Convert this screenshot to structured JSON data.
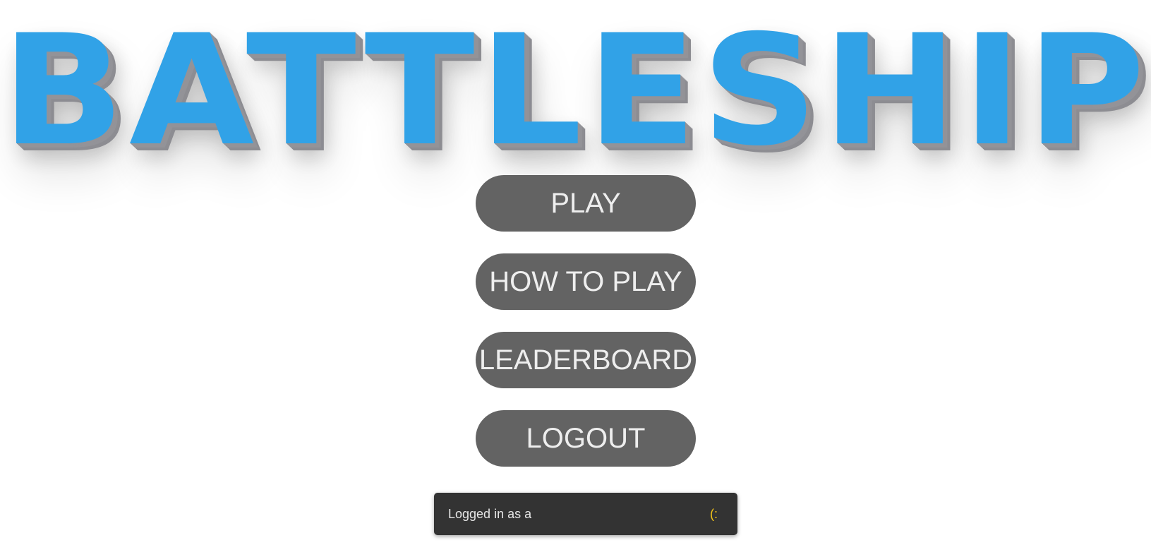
{
  "title": "BATTLESHIP",
  "menu": {
    "play_label": "PLAY",
    "how_to_play_label": "HOW TO PLAY",
    "leaderboard_label": "LEADERBOARD",
    "logout_label": "LOGOUT"
  },
  "status": {
    "text": "Logged in as a",
    "smiley": "(:"
  },
  "colors": {
    "title": "#31a2e7",
    "title_depth": "#939398",
    "button_bg": "#636363",
    "button_text": "#eeeeee",
    "status_bg": "#333333",
    "status_text": "#e6e6e6",
    "smiley": "#f5c518",
    "background": "#ffffff"
  }
}
